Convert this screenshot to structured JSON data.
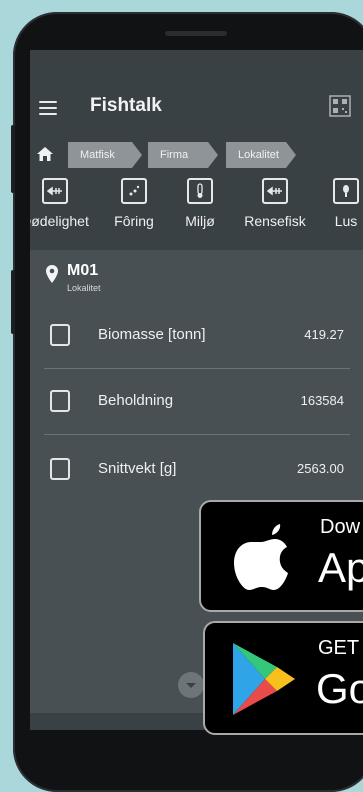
{
  "app": {
    "title": "Fishtalk"
  },
  "breadcrumb": [
    "Matfisk",
    "Firma",
    "Lokalitet"
  ],
  "tabs": [
    {
      "label": "Dødelighet",
      "icon": "fish-icon"
    },
    {
      "label": "Fôring",
      "icon": "feed-icon"
    },
    {
      "label": "Miljø",
      "icon": "thermometer-icon"
    },
    {
      "label": "Rensefisk",
      "icon": "fish-icon"
    },
    {
      "label": "Lus",
      "icon": "lice-icon"
    }
  ],
  "site": {
    "name": "M01",
    "type": "Lokalitet"
  },
  "metrics": [
    {
      "label": "Biomasse [tonn]",
      "value": "419.27"
    },
    {
      "label": "Beholdning",
      "value": "163584"
    },
    {
      "label": "Snittvekt [g]",
      "value": "2563.00"
    }
  ],
  "badges": {
    "apple": {
      "small": "Dow",
      "big": "Ap"
    },
    "google": {
      "small": "GET",
      "big": "Go"
    }
  }
}
